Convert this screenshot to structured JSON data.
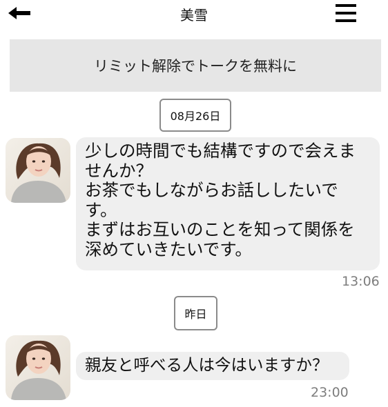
{
  "header": {
    "back_icon": "back-arrow-icon",
    "title": "美雪",
    "menu_icon": "hamburger-menu-icon"
  },
  "banner": {
    "label": "リミット解除でトークを無料に"
  },
  "chat": {
    "messages": [
      {
        "date_label": "08月26日",
        "sender_avatar": "avatar-photo",
        "lines": [
          "少しの時間でも結構ですので会えま",
          "せんか？",
          "お茶でもしながらお話ししたいで",
          "す。",
          "まずはお互いのことを知って関係を",
          "深めていきたいです。"
        ],
        "time": "13:06"
      },
      {
        "date_label": "昨日",
        "sender_avatar": "avatar-photo",
        "lines": [
          "親友と呼べる人は今はいますか？"
        ],
        "time": "23:00"
      }
    ]
  },
  "colors": {
    "banner_bg": "#e6e6e6",
    "bubble_bg": "#efefef",
    "time_text": "#7d7d7d",
    "chip_border": "#8a8a8a"
  }
}
